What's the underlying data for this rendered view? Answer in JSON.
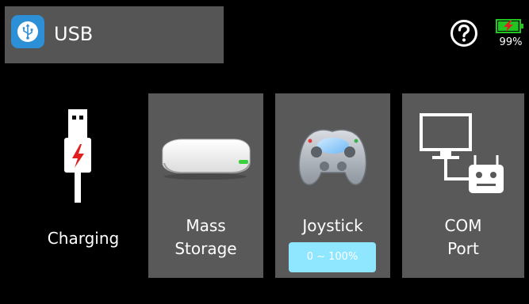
{
  "header": {
    "title": "USB",
    "app_icon": "usb-icon",
    "help_icon": "help-circle-icon",
    "battery": {
      "percent_label": "99%",
      "level": 0.99,
      "icon": "battery-charging-icon"
    }
  },
  "charging": {
    "label": "Charging",
    "icon": "usb-cable-charging-icon"
  },
  "modes": [
    {
      "label_line1": "Mass",
      "label_line2": "Storage",
      "icon": "external-drive-icon"
    },
    {
      "label": "Joystick",
      "range_label": "0 ~ 100%",
      "icon": "gamepad-icon"
    },
    {
      "label_line1": "COM",
      "label_line2": "Port",
      "icon": "monitor-transmitter-icon"
    }
  ],
  "colors": {
    "background": "#000000",
    "title_bar": "#555555",
    "tile": "#595959",
    "accent_blue": "#2d8fd6",
    "pill": "#8fe6ff",
    "battery_green": "#22c422",
    "charge_red": "#e02020"
  }
}
